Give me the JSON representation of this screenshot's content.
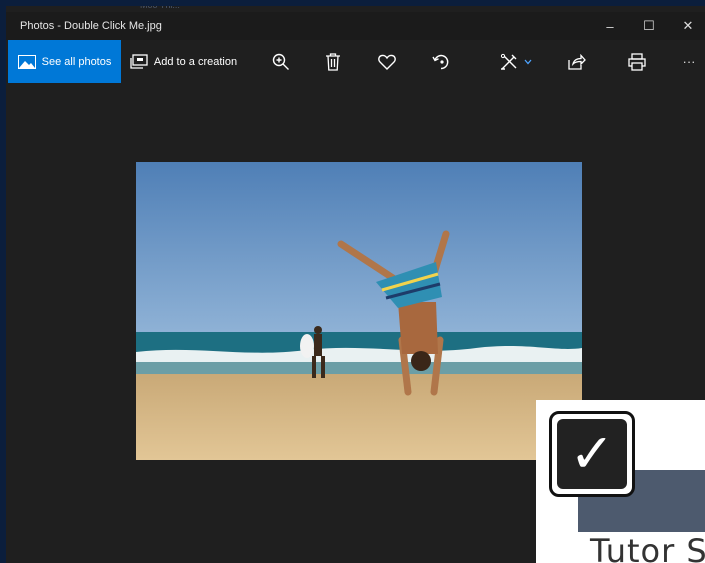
{
  "window": {
    "title": "Photos - Double Click Me.jpg",
    "behind_text": "Moo Thi..."
  },
  "window_controls": {
    "minimize": "–",
    "maximize": "☐",
    "close": "✕"
  },
  "toolbar": {
    "see_all_photos": "See all photos",
    "add_to_creation": "Add to a creation",
    "more": "···",
    "icons": [
      "zoom-in-icon",
      "delete-icon",
      "favorite-heart-icon",
      "rotate-icon",
      "edit-create-icon",
      "share-icon",
      "print-icon",
      "more-icon"
    ]
  },
  "photo": {
    "description_colors": {
      "sky": "#5a86b8",
      "sea": "#1f7d8c",
      "sand": "#d8bc8a"
    }
  },
  "overlay": {
    "check_mark": "✓",
    "text": "Tutor S"
  }
}
